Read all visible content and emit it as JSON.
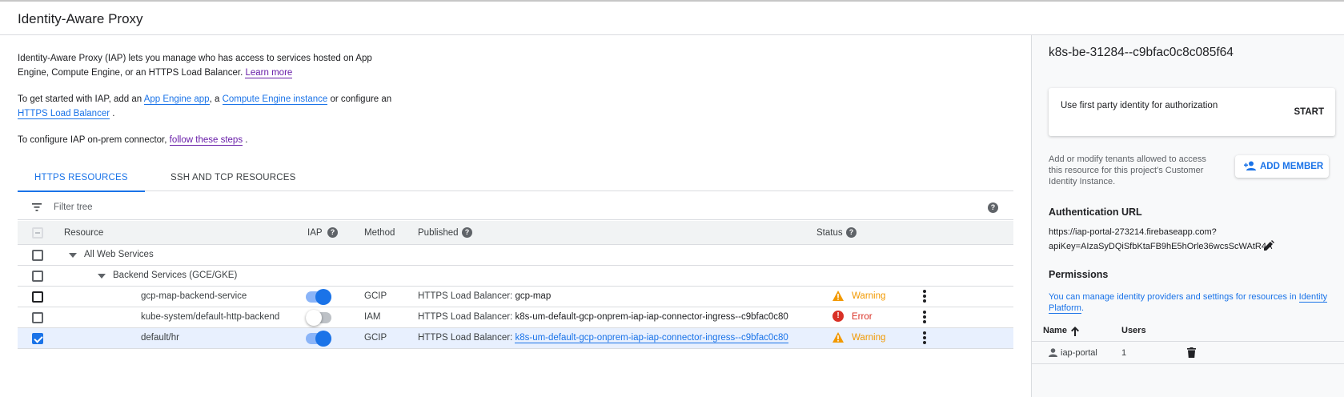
{
  "header": {
    "title": "Identity-Aware Proxy"
  },
  "intro": {
    "p1_text": "Identity-Aware Proxy (IAP) lets you manage who has access to services hosted on App Engine, Compute Engine, or an HTTPS Load Balancer.",
    "p1_link": "Learn more",
    "p2_a": "To get started with IAP, add an",
    "p2_link1": "App Engine app",
    "p2_b": ", a",
    "p2_link2": "Compute Engine instance",
    "p2_c": "or configure an",
    "p2_link3": "HTTPS Load Balancer",
    "p2_d": ".",
    "p3_a": "To configure IAP on-prem connector,",
    "p3_link": "follow these steps",
    "p3_b": "."
  },
  "tabs": [
    {
      "label": "HTTPS RESOURCES",
      "active": true
    },
    {
      "label": "SSH AND TCP RESOURCES",
      "active": false
    }
  ],
  "filter": {
    "placeholder": "Filter tree"
  },
  "table": {
    "columns": {
      "resource": "Resource",
      "iap": "IAP",
      "method": "Method",
      "published": "Published",
      "status": "Status"
    },
    "rows": [
      {
        "name": "All Web Services",
        "indent": 0,
        "expandable": true
      },
      {
        "name": "Backend Services (GCE/GKE)",
        "indent": 1,
        "expandable": true
      },
      {
        "name": "gcp-map-backend-service",
        "iap": true,
        "method": "GCIP",
        "published_prefix": "HTTPS Load Balancer:",
        "published_value": "gcp-map",
        "status": "Warning",
        "checked": false
      },
      {
        "name": "kube-system/default-http-backend",
        "iap": false,
        "method": "IAM",
        "published_prefix": "HTTPS Load Balancer:",
        "published_value": "k8s-um-default-gcp-onprem-iap-iap-connector-ingress--c9bfac0c80",
        "status": "Error",
        "checked": false
      },
      {
        "name": "default/hr",
        "iap": true,
        "method": "GCIP",
        "published_prefix": "HTTPS Load Balancer:",
        "published_value": "k8s-um-default-gcp-onprem-iap-iap-connector-ingress--c9bfac0c80",
        "status": "Warning",
        "checked": true
      }
    ]
  },
  "side": {
    "title": "k8s-be-31284--c9bfac0c8c085f64",
    "card_text": "Use first party identity for authorization",
    "card_button": "START",
    "tenant_desc": "Add or modify tenants allowed to access this resource for this project's Customer Identity Instance.",
    "add_member": "ADD MEMBER",
    "auth_heading": "Authentication URL",
    "auth_url_line1": "https://iap-portal-273214.firebaseapp.com?",
    "auth_url_line2": "apiKey=AIzaSyDQiSfbKtaFB9hE5hOrle36wcsScWAtR4A",
    "perm_heading": "Permissions",
    "perm_desc_a": "You can manage identity providers and settings for resources in",
    "perm_link": "Identity Platform",
    "perm_desc_b": ".",
    "perm_columns": {
      "name": "Name",
      "users": "Users"
    },
    "perm_rows": [
      {
        "name": "iap-portal",
        "users": "1"
      }
    ]
  },
  "colors": {
    "accent": "#1a73e8",
    "warning": "#f29900",
    "error": "#d93025",
    "visited_link": "#681da8"
  }
}
